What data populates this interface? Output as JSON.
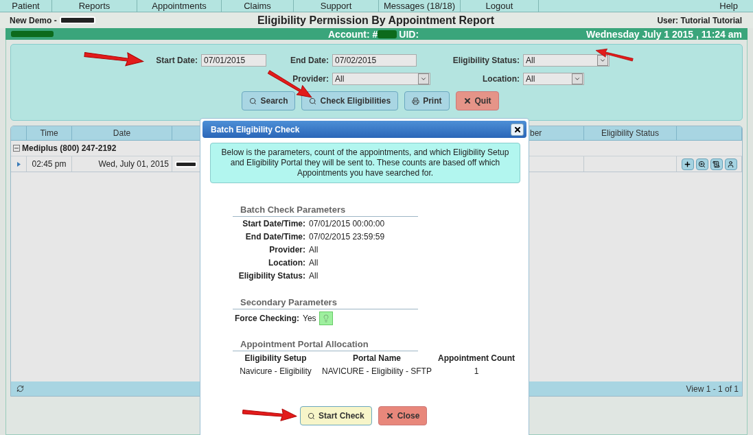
{
  "menu": [
    {
      "label": "Patient",
      "selected": false
    },
    {
      "label": "Reports",
      "selected": false
    },
    {
      "label": "Appointments",
      "selected": false
    },
    {
      "label": "Claims",
      "selected": false
    },
    {
      "label": "Support",
      "selected": false
    },
    {
      "label": "Messages (18/18)",
      "selected": false
    },
    {
      "label": "Logout",
      "selected": false
    }
  ],
  "help": "Help",
  "header": {
    "practice": "New Demo -",
    "title": "Eligibility Permission By Appointment Report",
    "user": "User: Tutorial Tutorial"
  },
  "account_bar": {
    "account": "Account: #",
    "uid": "UID:",
    "datetime": "Wednesday July 1 2015 , 11:24 am"
  },
  "filters": {
    "start_label": "Start Date:",
    "start_value": "07/01/2015",
    "end_label": "End Date:",
    "end_value": "07/02/2015",
    "status_label": "Eligibility Status:",
    "status_value": "All",
    "provider_label": "Provider:",
    "provider_value": "All",
    "location_label": "Location:",
    "location_value": "All"
  },
  "buttons": [
    {
      "label": "Search",
      "kind": "search"
    },
    {
      "label": "Check Eligibilities",
      "kind": "check"
    },
    {
      "label": "Print",
      "kind": "print"
    },
    {
      "label": "Quit",
      "kind": "quit"
    }
  ],
  "grid": {
    "columns": [
      "Time",
      "Date",
      "",
      "ber",
      "Eligibility Status"
    ],
    "group": {
      "label": "Mediplus  (800) 247-2192",
      "expanded": true
    },
    "rows": [
      {
        "time": "02:45 pm",
        "date": "Wed, July 01, 2015"
      }
    ],
    "footer": "View 1 - 1 of 1"
  },
  "dialog": {
    "title": "Batch Eligibility Check",
    "note": "Below is the parameters, count of the appointments, and which Eligibility Setup and Eligibility Portal they will be sent to. These counts are based off which Appointments you have searched for.",
    "batch_heading": "Batch Check Parameters",
    "params": [
      {
        "label": "Start Date/Time:",
        "value": "07/01/2015 00:00:00"
      },
      {
        "label": "End Date/Time:",
        "value": "07/02/2015 23:59:59"
      },
      {
        "label": "Provider:",
        "value": "All"
      },
      {
        "label": "Location:",
        "value": "All"
      },
      {
        "label": "Eligibility Status:",
        "value": "All"
      }
    ],
    "secondary_heading": "Secondary Parameters",
    "force": {
      "label": "Force Checking:",
      "value": "Yes",
      "on": true
    },
    "allocation_heading": "Appointment Portal Allocation",
    "allocation_columns": [
      "Eligibility Setup",
      "Portal Name",
      "Appointment Count"
    ],
    "allocation_rows": [
      [
        "Navicure - Eligibility",
        "NAVICURE - Eligibility - SFTP",
        "1"
      ]
    ],
    "buttons": [
      {
        "label": "Start Check",
        "kind": "start"
      },
      {
        "label": "Close",
        "kind": "close"
      }
    ]
  }
}
